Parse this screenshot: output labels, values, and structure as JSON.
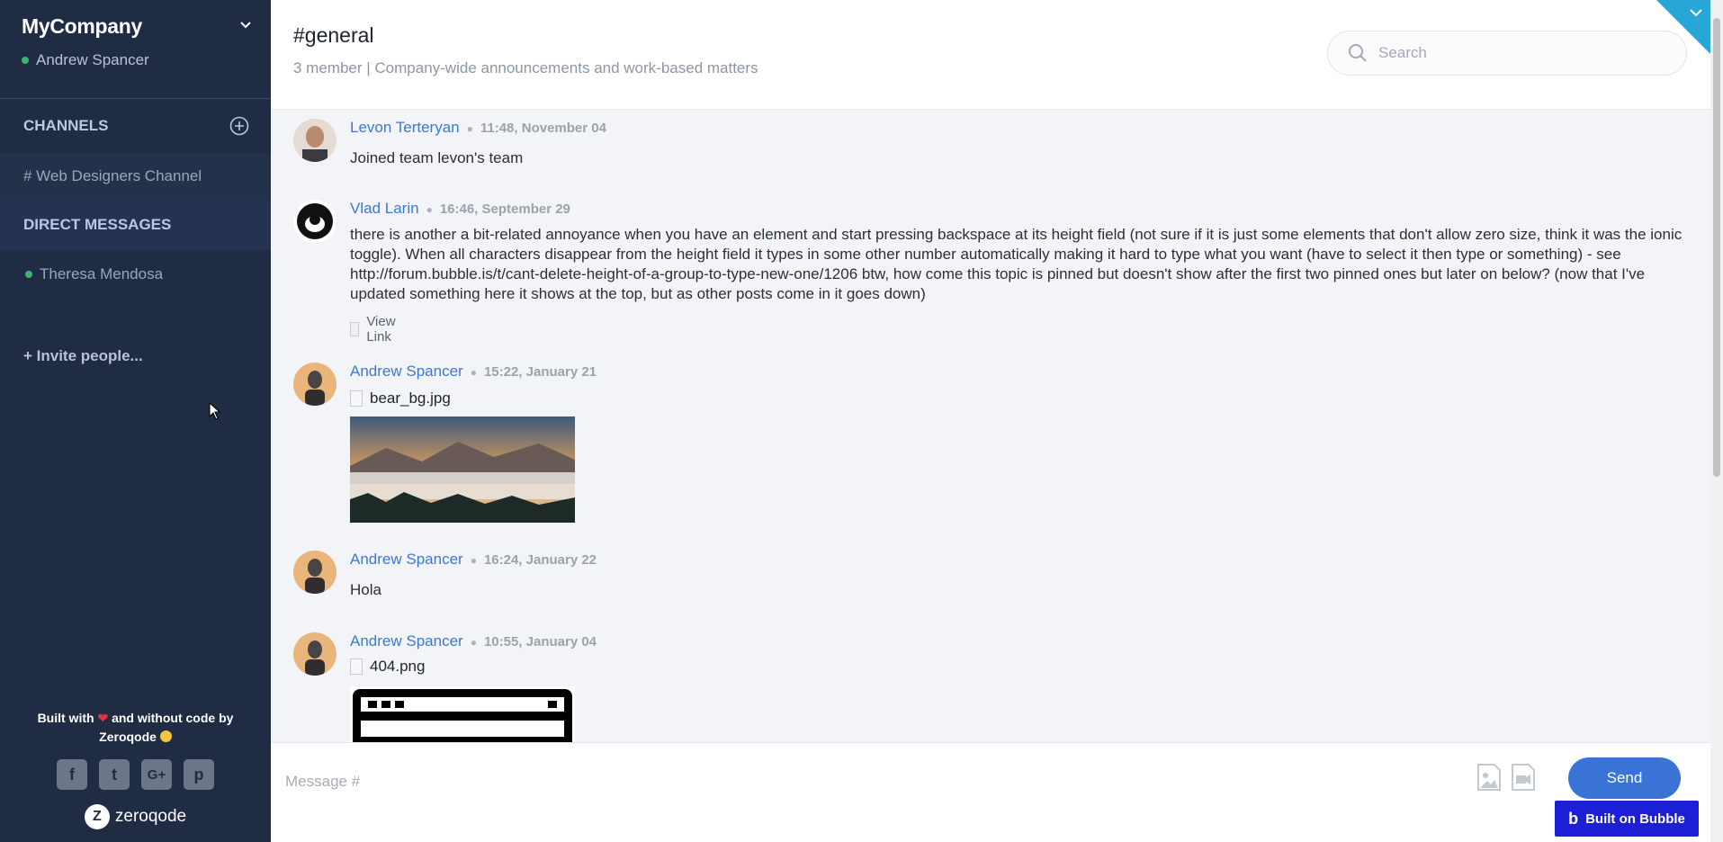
{
  "sidebar": {
    "team_name": "MyCompany",
    "current_user": "Andrew Spancer",
    "channels_heading": "CHANNELS",
    "channels": [
      {
        "label": "# Web Designers Channel"
      }
    ],
    "dm_heading": "DIRECT MESSAGES",
    "direct_messages": [
      {
        "label": "Theresa Mendosa"
      }
    ],
    "invite_label": "+ Invite people...",
    "built_with_line1": "Built with",
    "built_with_line1b": "and without code by",
    "built_with_line2": "Zeroqode",
    "social_icons": [
      "facebook-icon",
      "twitter-icon",
      "google-plus-icon",
      "pinterest-icon"
    ],
    "social_glyphs": [
      "f",
      "t",
      "G+",
      "p"
    ],
    "brand": "zeroqode",
    "brand_mark": "Z"
  },
  "header": {
    "channel_title": "#general",
    "channel_desc": "3 member | Company-wide announcements and work-based matters",
    "search_placeholder": "Search"
  },
  "messages": [
    {
      "author": "Levon Terteryan",
      "time": "11:48, November 04",
      "text": "Joined team levon's team"
    },
    {
      "author": "Vlad Larin",
      "time": "16:46, September 29",
      "text": "there is another a bit-related annoyance when you have an element and start pressing backspace at its height field (not sure if it is just some elements that don't allow zero size, think it was the ionic toggle). When all characters disappear from the height field it types in some other number automatically making it hard to type what you want (have to select it then type or something) - see http://forum.bubble.is/t/cant-delete-height-of-a-group-to-type-new-one/1206  btw, how come this topic is pinned but doesn't show after the first two pinned ones but later on below? (now that I've updated something here it shows at the top, but as other posts come in it goes down)",
      "link_label": "View Link"
    },
    {
      "author": "Andrew Spancer",
      "time": "15:22, January 21",
      "file": "bear_bg.jpg"
    },
    {
      "author": "Andrew Spancer",
      "time": "16:24, January 22",
      "text": "Hola"
    },
    {
      "author": "Andrew Spancer",
      "time": "10:55, January 04",
      "file": "404.png"
    }
  ],
  "composer": {
    "placeholder": "Message #",
    "send_label": "Send",
    "badge_label": "Built on Bubble",
    "badge_mark": "b"
  },
  "colors": {
    "sidebar_bg": "#1f2c43",
    "accent": "#3a73d6",
    "author": "#3b79d4",
    "corner": "#27a6d8",
    "bubble_badge": "#1d1fd6"
  }
}
